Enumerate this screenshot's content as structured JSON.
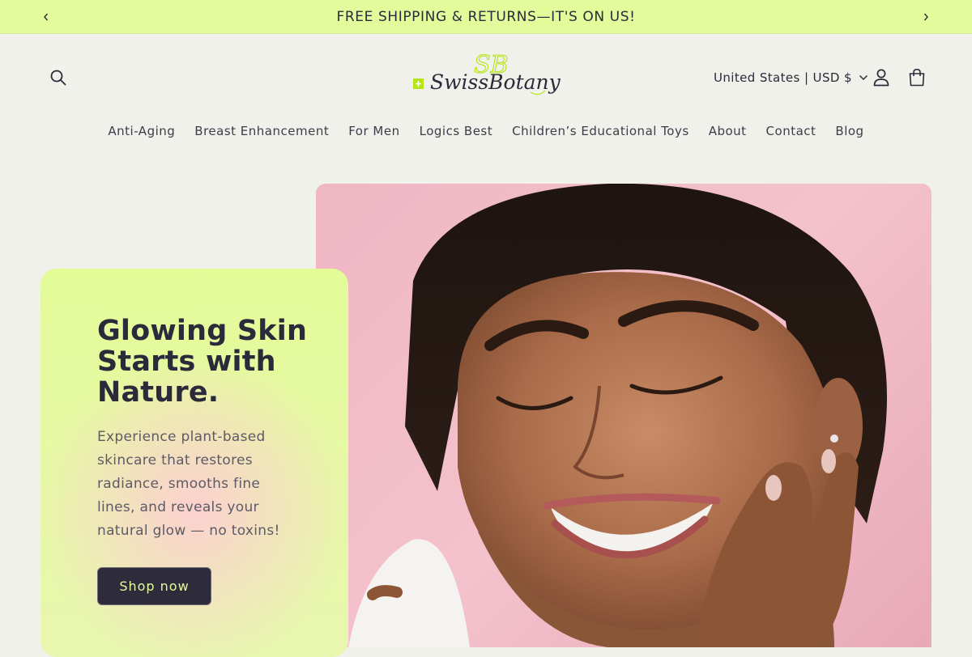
{
  "announcement": {
    "text": "FREE SHIPPING & RETURNS—IT'S ON US!",
    "prev_icon": "chevron-left-icon",
    "next_icon": "chevron-right-icon"
  },
  "header": {
    "logo_text": "SwissBotany",
    "logo_monogram": "SB",
    "country_selector": "United States | USD $",
    "icons": [
      "search-icon",
      "account-icon",
      "cart-icon"
    ]
  },
  "nav": {
    "items": [
      "Anti-Aging",
      "Breast Enhancement",
      "For Men",
      "Logics Best",
      "Children’s Educational Toys",
      "About",
      "Contact",
      "Blog"
    ]
  },
  "hero": {
    "title": "Glowing Skin Starts with Nature.",
    "description": "Experience plant-based skincare that restores radiance, smooths fine lines, and reveals your natural glow — no toxins!",
    "cta_label": "Shop now"
  },
  "colors": {
    "announcement_bg": "#e4fb9c",
    "page_bg": "#f0f1ea",
    "brand_green": "#b6e41a",
    "text_dark": "#2b2a3a",
    "button_bg": "#2e2b3b",
    "button_text": "#e4fb9c",
    "hero_pink": "#efb6c4"
  }
}
